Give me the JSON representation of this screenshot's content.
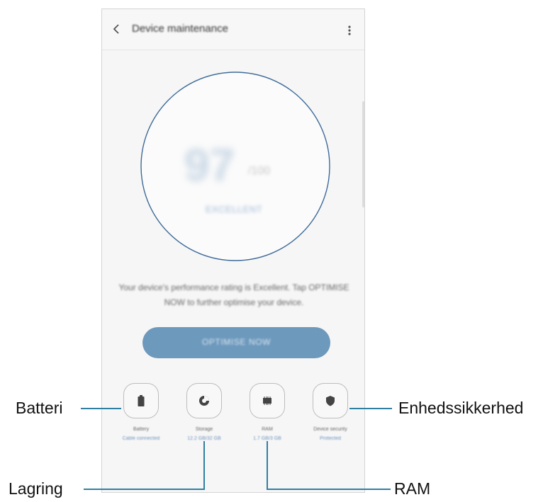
{
  "screen": {
    "title": "Device maintenance",
    "score": {
      "value": "97",
      "unit": "/100",
      "status": "EXCELLENT"
    },
    "message": "Your device's performance rating is Excellent. Tap OPTIMISE NOW to further optimise your device.",
    "optimise_label": "OPTIMISE NOW",
    "features": [
      {
        "name": "Battery",
        "status": "Cable connected",
        "icon": "battery-icon"
      },
      {
        "name": "Storage",
        "status": "12.2 GB/32 GB",
        "icon": "storage-icon"
      },
      {
        "name": "RAM",
        "status": "1.7 GB/3 GB",
        "icon": "ram-chip-icon"
      },
      {
        "name": "Device security",
        "status": "Protected",
        "icon": "shield-icon"
      }
    ]
  },
  "callouts": {
    "battery": "Batteri",
    "storage": "Lagring",
    "ram": "RAM",
    "security": "Enhedssikkerhed"
  },
  "colors": {
    "accent": "#6d99bd",
    "ring": "#3e6a99",
    "callout_line": "#2f7fa3"
  }
}
